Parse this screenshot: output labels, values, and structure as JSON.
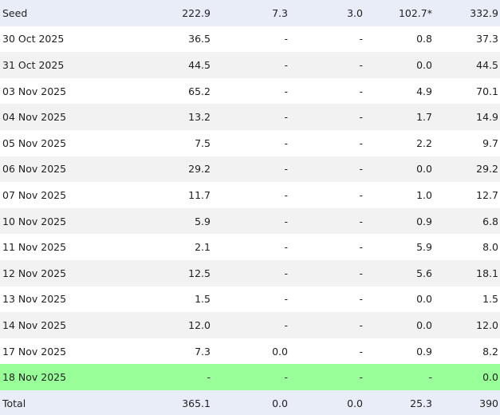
{
  "table": {
    "seed": [
      "Seed",
      "222.9",
      "7.3",
      "3.0",
      "102.7*",
      "332.9"
    ],
    "rows": [
      [
        "30 Oct 2025",
        "36.5",
        "-",
        "-",
        "0.8",
        "37.3"
      ],
      [
        "31 Oct 2025",
        "44.5",
        "-",
        "-",
        "0.0",
        "44.5"
      ],
      [
        "03 Nov 2025",
        "65.2",
        "-",
        "-",
        "4.9",
        "70.1"
      ],
      [
        "04 Nov 2025",
        "13.2",
        "-",
        "-",
        "1.7",
        "14.9"
      ],
      [
        "05 Nov 2025",
        "7.5",
        "-",
        "-",
        "2.2",
        "9.7"
      ],
      [
        "06 Nov 2025",
        "29.2",
        "-",
        "-",
        "0.0",
        "29.2"
      ],
      [
        "07 Nov 2025",
        "11.7",
        "-",
        "-",
        "1.0",
        "12.7"
      ],
      [
        "10 Nov 2025",
        "5.9",
        "-",
        "-",
        "0.9",
        "6.8"
      ],
      [
        "11 Nov 2025",
        "2.1",
        "-",
        "-",
        "5.9",
        "8.0"
      ],
      [
        "12 Nov 2025",
        "12.5",
        "-",
        "-",
        "5.6",
        "18.1"
      ],
      [
        "13 Nov 2025",
        "1.5",
        "-",
        "-",
        "0.0",
        "1.5"
      ],
      [
        "14 Nov 2025",
        "12.0",
        "-",
        "-",
        "0.0",
        "12.0"
      ],
      [
        "17 Nov 2025",
        "7.3",
        "0.0",
        "-",
        "0.9",
        "8.2"
      ],
      [
        "18 Nov 2025",
        "-",
        "-",
        "-",
        "-",
        "0.0"
      ]
    ],
    "total": [
      "Total",
      "365.1",
      "0.0",
      "0.0",
      "25.3",
      "390"
    ],
    "highlight_color": "#99ff99",
    "header_color": "#e9edf8",
    "alt_row_color": "#f2f2f2"
  }
}
